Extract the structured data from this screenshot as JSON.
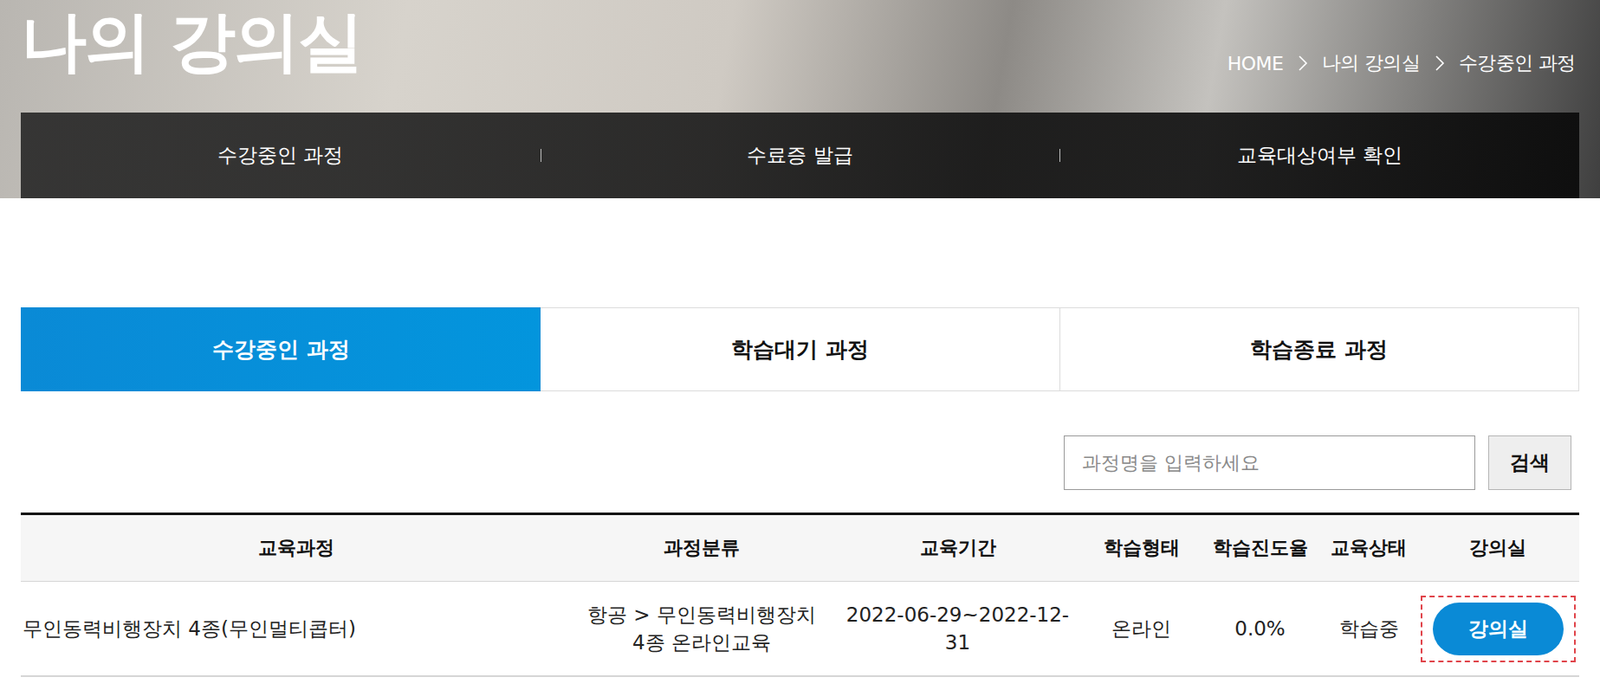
{
  "header": {
    "title": "나의 강의실",
    "breadcrumb": [
      "HOME",
      "나의 강의실",
      "수강중인 과정"
    ]
  },
  "nav": [
    {
      "label": "수강중인 과정"
    },
    {
      "label": "수료증 발급"
    },
    {
      "label": "교육대상여부 확인"
    }
  ],
  "tabs": [
    {
      "label": "수강중인 과정",
      "selected": true
    },
    {
      "label": "학습대기 과정",
      "selected": false
    },
    {
      "label": "학습종료 과정",
      "selected": false
    }
  ],
  "search": {
    "placeholder": "과정명을 입력하세요",
    "button": "검색"
  },
  "table": {
    "columns": [
      "교육과정",
      "과정분류",
      "교육기간",
      "학습형태",
      "학습진도율",
      "교육상태",
      "강의실"
    ],
    "rows": [
      {
        "cells": [
          "무인동력비행장치 4종(무인멀티콥터)",
          "항공 > 무인동력비행장치 4종 온라인교육",
          "2022-06-29~2022-12-31",
          "온라인",
          "0.0%",
          "학습중"
        ],
        "button": "강의실",
        "highlighted": true
      }
    ]
  }
}
